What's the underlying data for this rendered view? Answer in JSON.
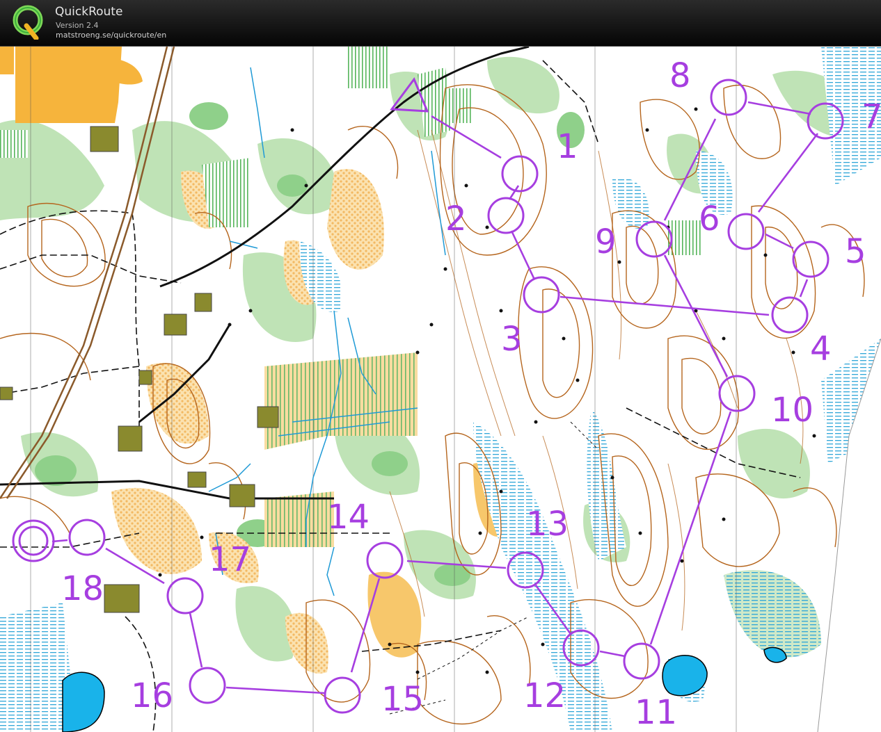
{
  "app": {
    "name": "QuickRoute",
    "version": "Version 2.4",
    "url": "matstroeng.se/quickroute/en",
    "logo_letter": "Q"
  },
  "course": {
    "color": "#a63ee0",
    "start_symbol": "triangle",
    "controls": [
      {
        "label": "1"
      },
      {
        "label": "2"
      },
      {
        "label": "3"
      },
      {
        "label": "4"
      },
      {
        "label": "5"
      },
      {
        "label": "6"
      },
      {
        "label": "7"
      },
      {
        "label": "8"
      },
      {
        "label": "9"
      },
      {
        "label": "10"
      },
      {
        "label": "11"
      },
      {
        "label": "12"
      },
      {
        "label": "13"
      },
      {
        "label": "14"
      },
      {
        "label": "15"
      },
      {
        "label": "16"
      },
      {
        "label": "17"
      },
      {
        "label": "18"
      }
    ],
    "finish_symbol": "double-circle"
  },
  "map_colors": {
    "open_land": "#f7c76b",
    "rough_open": "#fbe2b0",
    "field": "#f6b43c",
    "forest_green": "#a7d9a0",
    "forest_dark": "#7cc47a",
    "water": "#19b3ea",
    "marsh": "#2fa6d8",
    "contour": "#b5651d",
    "road": "#111111",
    "building": "#7a7a2a"
  }
}
